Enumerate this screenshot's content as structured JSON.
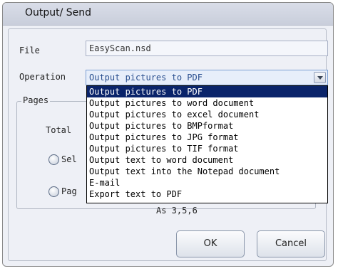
{
  "dialog": {
    "title": "Output/ Send"
  },
  "form": {
    "file_label": "File",
    "file_value": "EasyScan.nsd",
    "operation_label": "Operation",
    "operation_value": "Output pictures to PDF"
  },
  "dropdown": {
    "options": [
      "Output pictures to PDF",
      "Output pictures to word document",
      "Output pictures to excel document",
      "Output pictures to BMPformat",
      "Output pictures to JPG format",
      "Output pictures to TIF format",
      "Output text to word document",
      "Output text into the Notepad document",
      "E-mail",
      "Export text to PDF"
    ],
    "selected_index": 0
  },
  "pages": {
    "group_label": "Pages",
    "total_label": "Total",
    "radio1_label": "Sel",
    "radio2_label": "Pag",
    "hint": "As 3,5,6"
  },
  "buttons": {
    "ok": "OK",
    "cancel": "Cancel"
  }
}
